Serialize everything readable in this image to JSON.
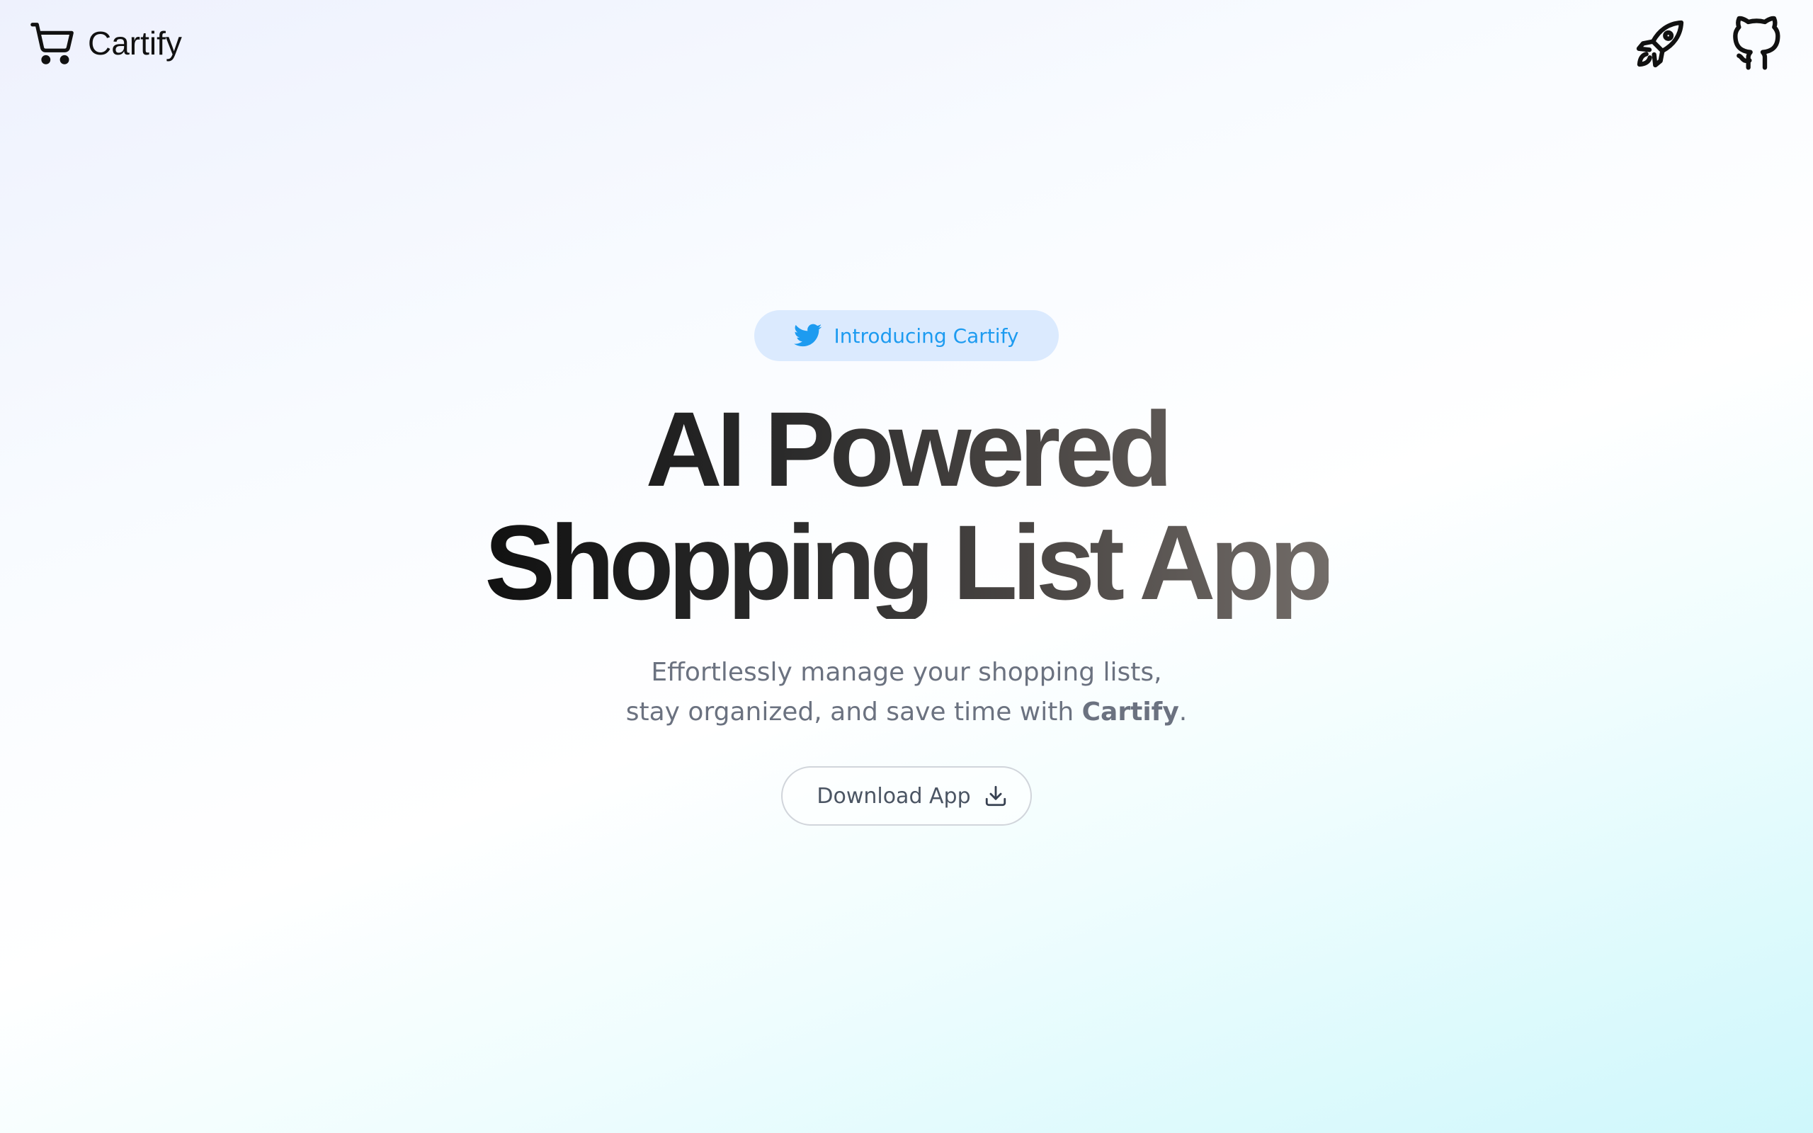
{
  "header": {
    "brand_name": "Cartify",
    "brand_icon": "shopping-cart-icon",
    "right_icons": [
      "rocket-icon",
      "github-icon"
    ]
  },
  "hero": {
    "badge": {
      "label": "Introducing Cartify",
      "icon": "twitter-icon"
    },
    "headline_line1": "AI Powered",
    "headline_line2": "Shopping List App",
    "subtitle_line1": "Effortlessly manage your shopping lists,",
    "subtitle_line2_prefix": "stay organized, and save time with",
    "subtitle_line2_brand": "Cartify",
    "subtitle_line2_suffix": ".",
    "download_button": {
      "label": "Download App",
      "icon": "download-icon"
    }
  },
  "colors": {
    "badge_background": "#dbeafe",
    "badge_text": "#1d9bf0",
    "subtitle_text": "#6b7280",
    "background_start": "#eef1fd",
    "background_end": "#cef7fb"
  }
}
